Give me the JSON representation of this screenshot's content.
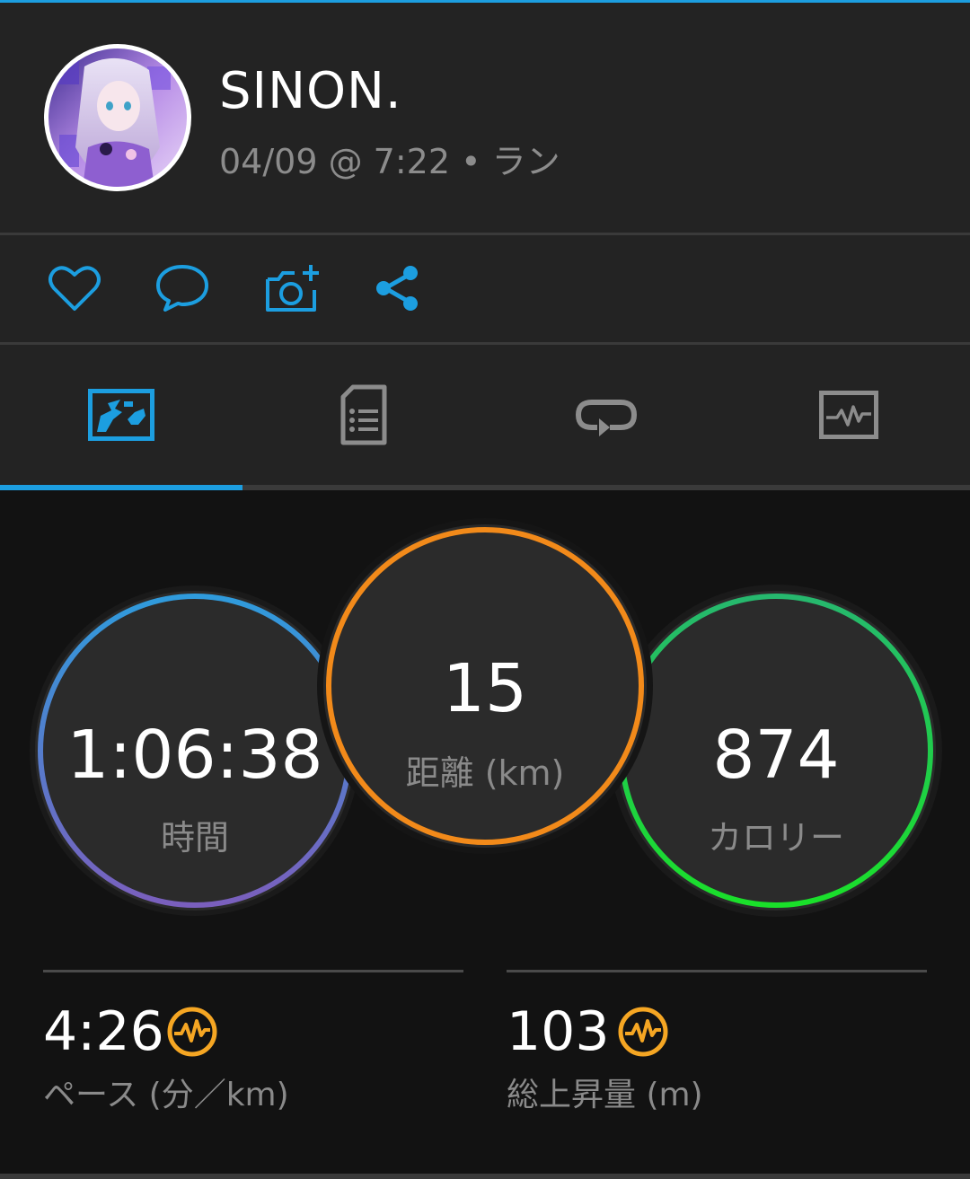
{
  "header": {
    "user_name": "SINON.",
    "activity_meta": "04/09 @ 7:22 • ラン"
  },
  "actions": [
    {
      "icon": "heart-icon"
    },
    {
      "icon": "comment-icon"
    },
    {
      "icon": "add-photo-icon"
    },
    {
      "icon": "share-icon"
    }
  ],
  "tabs": [
    {
      "icon": "map-icon",
      "active": true
    },
    {
      "icon": "details-icon",
      "active": false
    },
    {
      "icon": "laps-icon",
      "active": false
    },
    {
      "icon": "chart-icon",
      "active": false
    }
  ],
  "colors": {
    "accent": "#1c9ee0",
    "distance_ring": "#f28a1a",
    "calories_ring": "#1ad35a",
    "time_ring_top": "#2f9bdc",
    "time_ring_bottom": "#7a5fbd",
    "badge": "#f5a623"
  },
  "stats": {
    "time": {
      "value": "1:06:38",
      "label": "時間"
    },
    "distance": {
      "value": "15",
      "label": "距離 (km)"
    },
    "calories": {
      "value": "874",
      "label": "カロリー"
    }
  },
  "metrics": {
    "pace": {
      "value": "4:26",
      "label": "ペース (分／km)",
      "icon": "pulse-badge-icon"
    },
    "elevation": {
      "value": "103",
      "label": "総上昇量 (m)",
      "icon": "pulse-badge-icon"
    }
  }
}
